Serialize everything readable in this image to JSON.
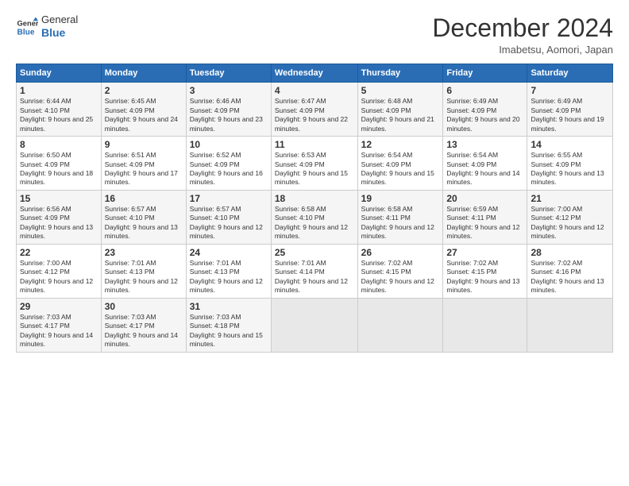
{
  "header": {
    "logo_line1": "General",
    "logo_line2": "Blue",
    "title": "December 2024",
    "subtitle": "Imabetsu, Aomori, Japan"
  },
  "calendar": {
    "days_of_week": [
      "Sunday",
      "Monday",
      "Tuesday",
      "Wednesday",
      "Thursday",
      "Friday",
      "Saturday"
    ],
    "weeks": [
      [
        {
          "day": "1",
          "sunrise": "Sunrise: 6:44 AM",
          "sunset": "Sunset: 4:10 PM",
          "daylight": "Daylight: 9 hours and 25 minutes."
        },
        {
          "day": "2",
          "sunrise": "Sunrise: 6:45 AM",
          "sunset": "Sunset: 4:09 PM",
          "daylight": "Daylight: 9 hours and 24 minutes."
        },
        {
          "day": "3",
          "sunrise": "Sunrise: 6:46 AM",
          "sunset": "Sunset: 4:09 PM",
          "daylight": "Daylight: 9 hours and 23 minutes."
        },
        {
          "day": "4",
          "sunrise": "Sunrise: 6:47 AM",
          "sunset": "Sunset: 4:09 PM",
          "daylight": "Daylight: 9 hours and 22 minutes."
        },
        {
          "day": "5",
          "sunrise": "Sunrise: 6:48 AM",
          "sunset": "Sunset: 4:09 PM",
          "daylight": "Daylight: 9 hours and 21 minutes."
        },
        {
          "day": "6",
          "sunrise": "Sunrise: 6:49 AM",
          "sunset": "Sunset: 4:09 PM",
          "daylight": "Daylight: 9 hours and 20 minutes."
        },
        {
          "day": "7",
          "sunrise": "Sunrise: 6:49 AM",
          "sunset": "Sunset: 4:09 PM",
          "daylight": "Daylight: 9 hours and 19 minutes."
        }
      ],
      [
        {
          "day": "8",
          "sunrise": "Sunrise: 6:50 AM",
          "sunset": "Sunset: 4:09 PM",
          "daylight": "Daylight: 9 hours and 18 minutes."
        },
        {
          "day": "9",
          "sunrise": "Sunrise: 6:51 AM",
          "sunset": "Sunset: 4:09 PM",
          "daylight": "Daylight: 9 hours and 17 minutes."
        },
        {
          "day": "10",
          "sunrise": "Sunrise: 6:52 AM",
          "sunset": "Sunset: 4:09 PM",
          "daylight": "Daylight: 9 hours and 16 minutes."
        },
        {
          "day": "11",
          "sunrise": "Sunrise: 6:53 AM",
          "sunset": "Sunset: 4:09 PM",
          "daylight": "Daylight: 9 hours and 15 minutes."
        },
        {
          "day": "12",
          "sunrise": "Sunrise: 6:54 AM",
          "sunset": "Sunset: 4:09 PM",
          "daylight": "Daylight: 9 hours and 15 minutes."
        },
        {
          "day": "13",
          "sunrise": "Sunrise: 6:54 AM",
          "sunset": "Sunset: 4:09 PM",
          "daylight": "Daylight: 9 hours and 14 minutes."
        },
        {
          "day": "14",
          "sunrise": "Sunrise: 6:55 AM",
          "sunset": "Sunset: 4:09 PM",
          "daylight": "Daylight: 9 hours and 13 minutes."
        }
      ],
      [
        {
          "day": "15",
          "sunrise": "Sunrise: 6:56 AM",
          "sunset": "Sunset: 4:09 PM",
          "daylight": "Daylight: 9 hours and 13 minutes."
        },
        {
          "day": "16",
          "sunrise": "Sunrise: 6:57 AM",
          "sunset": "Sunset: 4:10 PM",
          "daylight": "Daylight: 9 hours and 13 minutes."
        },
        {
          "day": "17",
          "sunrise": "Sunrise: 6:57 AM",
          "sunset": "Sunset: 4:10 PM",
          "daylight": "Daylight: 9 hours and 12 minutes."
        },
        {
          "day": "18",
          "sunrise": "Sunrise: 6:58 AM",
          "sunset": "Sunset: 4:10 PM",
          "daylight": "Daylight: 9 hours and 12 minutes."
        },
        {
          "day": "19",
          "sunrise": "Sunrise: 6:58 AM",
          "sunset": "Sunset: 4:11 PM",
          "daylight": "Daylight: 9 hours and 12 minutes."
        },
        {
          "day": "20",
          "sunrise": "Sunrise: 6:59 AM",
          "sunset": "Sunset: 4:11 PM",
          "daylight": "Daylight: 9 hours and 12 minutes."
        },
        {
          "day": "21",
          "sunrise": "Sunrise: 7:00 AM",
          "sunset": "Sunset: 4:12 PM",
          "daylight": "Daylight: 9 hours and 12 minutes."
        }
      ],
      [
        {
          "day": "22",
          "sunrise": "Sunrise: 7:00 AM",
          "sunset": "Sunset: 4:12 PM",
          "daylight": "Daylight: 9 hours and 12 minutes."
        },
        {
          "day": "23",
          "sunrise": "Sunrise: 7:01 AM",
          "sunset": "Sunset: 4:13 PM",
          "daylight": "Daylight: 9 hours and 12 minutes."
        },
        {
          "day": "24",
          "sunrise": "Sunrise: 7:01 AM",
          "sunset": "Sunset: 4:13 PM",
          "daylight": "Daylight: 9 hours and 12 minutes."
        },
        {
          "day": "25",
          "sunrise": "Sunrise: 7:01 AM",
          "sunset": "Sunset: 4:14 PM",
          "daylight": "Daylight: 9 hours and 12 minutes."
        },
        {
          "day": "26",
          "sunrise": "Sunrise: 7:02 AM",
          "sunset": "Sunset: 4:15 PM",
          "daylight": "Daylight: 9 hours and 12 minutes."
        },
        {
          "day": "27",
          "sunrise": "Sunrise: 7:02 AM",
          "sunset": "Sunset: 4:15 PM",
          "daylight": "Daylight: 9 hours and 13 minutes."
        },
        {
          "day": "28",
          "sunrise": "Sunrise: 7:02 AM",
          "sunset": "Sunset: 4:16 PM",
          "daylight": "Daylight: 9 hours and 13 minutes."
        }
      ],
      [
        {
          "day": "29",
          "sunrise": "Sunrise: 7:03 AM",
          "sunset": "Sunset: 4:17 PM",
          "daylight": "Daylight: 9 hours and 14 minutes."
        },
        {
          "day": "30",
          "sunrise": "Sunrise: 7:03 AM",
          "sunset": "Sunset: 4:17 PM",
          "daylight": "Daylight: 9 hours and 14 minutes."
        },
        {
          "day": "31",
          "sunrise": "Sunrise: 7:03 AM",
          "sunset": "Sunset: 4:18 PM",
          "daylight": "Daylight: 9 hours and 15 minutes."
        },
        {
          "day": "",
          "sunrise": "",
          "sunset": "",
          "daylight": ""
        },
        {
          "day": "",
          "sunrise": "",
          "sunset": "",
          "daylight": ""
        },
        {
          "day": "",
          "sunrise": "",
          "sunset": "",
          "daylight": ""
        },
        {
          "day": "",
          "sunrise": "",
          "sunset": "",
          "daylight": ""
        }
      ]
    ]
  }
}
